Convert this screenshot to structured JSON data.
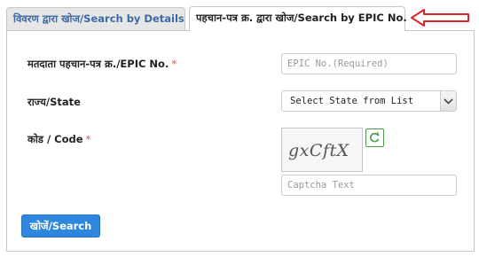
{
  "tabs": [
    {
      "label": "विवरण द्वारा खोज/Search by Details",
      "active": false
    },
    {
      "label": "पहचान-पत्र क्र. द्वारा खोज/Search by EPIC No.",
      "active": true
    }
  ],
  "form": {
    "epic": {
      "label": "मतदाता पहचान-पत्र क्र./EPIC No.",
      "required_mark": "*",
      "value": "",
      "placeholder": "EPIC No.(Required)"
    },
    "state": {
      "label": "राज्य/State",
      "selected": "Select State from List"
    },
    "code": {
      "label": "कोड / Code",
      "required_mark": "*",
      "captcha_image_text": "gxCftX",
      "value": "",
      "placeholder": "Captcha Text"
    },
    "submit_label": "खोजें/Search"
  },
  "colors": {
    "accent": "#2e86de",
    "inactive_tab_text": "#3d69a6",
    "arrow": "#d9262b",
    "required": "#d9534f",
    "refresh_border": "#4a9a4a"
  },
  "icons": {
    "refresh": "refresh-icon",
    "dropdown": "chevron-down-icon",
    "pointer": "arrow-left-icon"
  }
}
